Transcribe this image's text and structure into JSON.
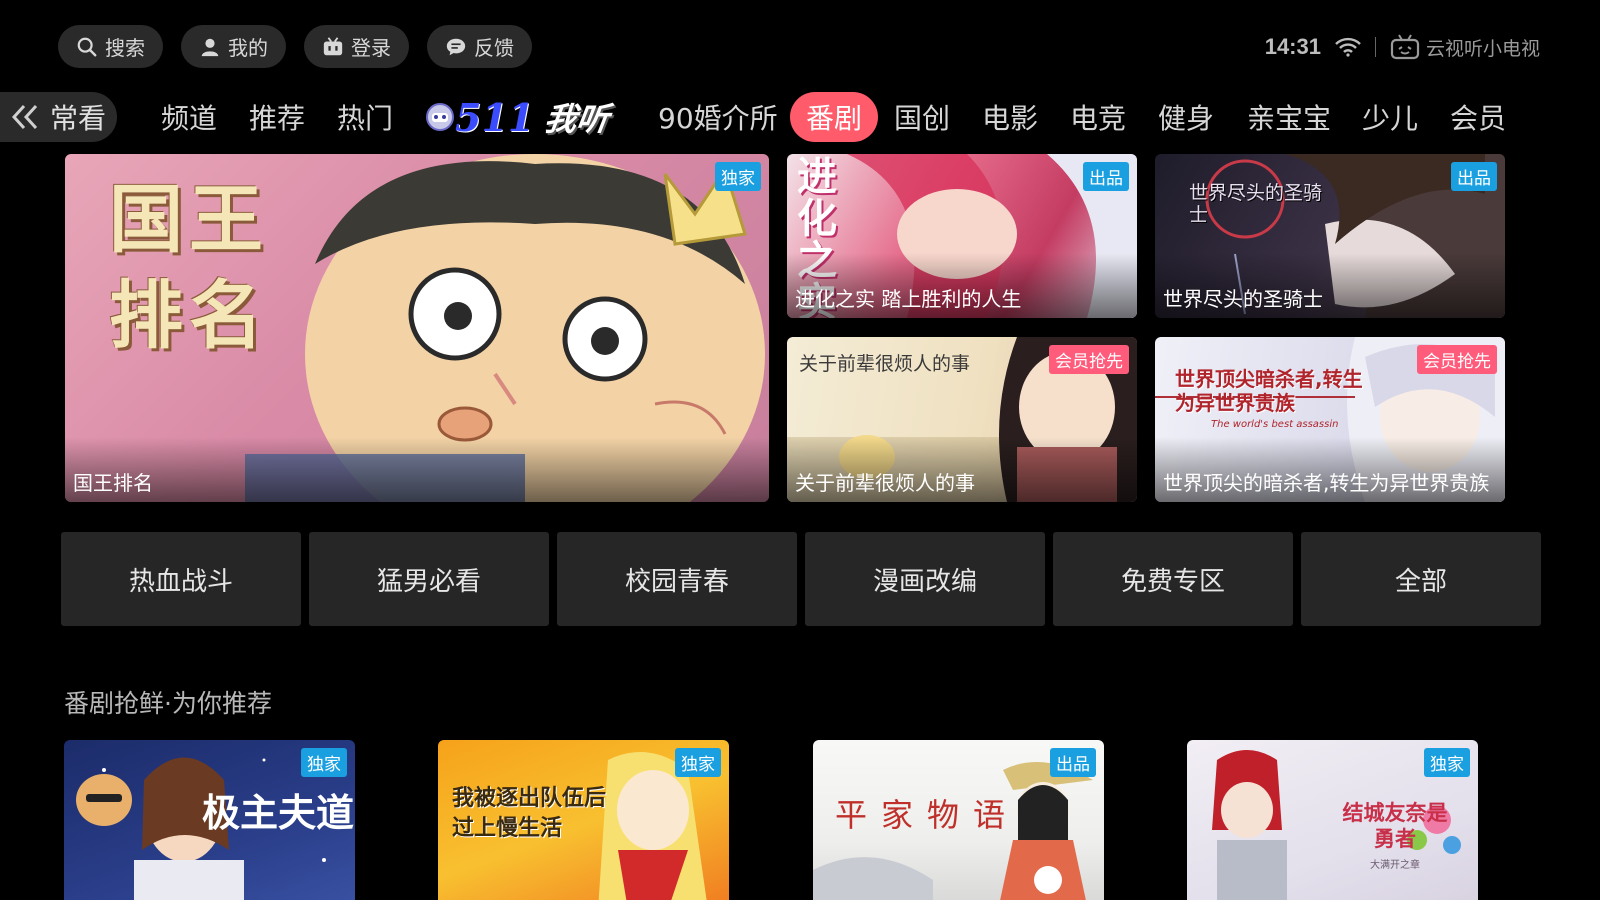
{
  "top": {
    "buttons": [
      {
        "label": "搜索",
        "icon": "search-icon"
      },
      {
        "label": "我的",
        "icon": "user-icon"
      },
      {
        "label": "登录",
        "icon": "tv-icon"
      },
      {
        "label": "反馈",
        "icon": "chat-icon"
      }
    ],
    "time": "14:31",
    "brand": "云视听小电视"
  },
  "nav": {
    "back_label": "常看",
    "items": [
      "频道",
      "推荐",
      "热门",
      "511",
      "我听",
      "90婚介所",
      "番剧",
      "国创",
      "电影",
      "电竞",
      "健身",
      "亲宝宝",
      "少儿",
      "会员"
    ],
    "active": "番剧"
  },
  "hero": {
    "main": {
      "title": "国王排名",
      "badge": "独家",
      "art_text": "国王排名"
    },
    "tiles": [
      {
        "title": "进化之实 踏上胜利的人生",
        "badge": "出品",
        "art_text": "进化之实"
      },
      {
        "title": "世界尽头的圣骑士",
        "badge": "出品",
        "art_text": "世界尽头的圣骑士"
      },
      {
        "title": "关于前辈很烦人的事",
        "badge": "会员抢先",
        "art_text": "关于前辈很烦人的事"
      },
      {
        "title": "世界顶尖的暗杀者,转生为异世界贵族",
        "badge": "会员抢先",
        "art_text": "世界顶尖暗杀者,转生为异世界贵族",
        "art_sub": "The world's best assassin"
      }
    ]
  },
  "categories": [
    "热血战斗",
    "猛男必看",
    "校园青春",
    "漫画改编",
    "免费专区",
    "全部"
  ],
  "section": {
    "title": "番剧抢鲜·为你推荐",
    "items": [
      {
        "badge": "独家",
        "art_text": "极主夫道"
      },
      {
        "badge": "独家",
        "art_text": "我被逐出队伍后过上慢生活"
      },
      {
        "badge": "出品",
        "art_text": "平家物语"
      },
      {
        "badge": "独家",
        "art_text": "结城友奈是勇者",
        "art_sub": "大满开之章"
      }
    ]
  },
  "colors": {
    "accent": "#ff5b6a",
    "badge_blue": "#1aa0e0",
    "badge_pink": "#ff5b7a"
  }
}
